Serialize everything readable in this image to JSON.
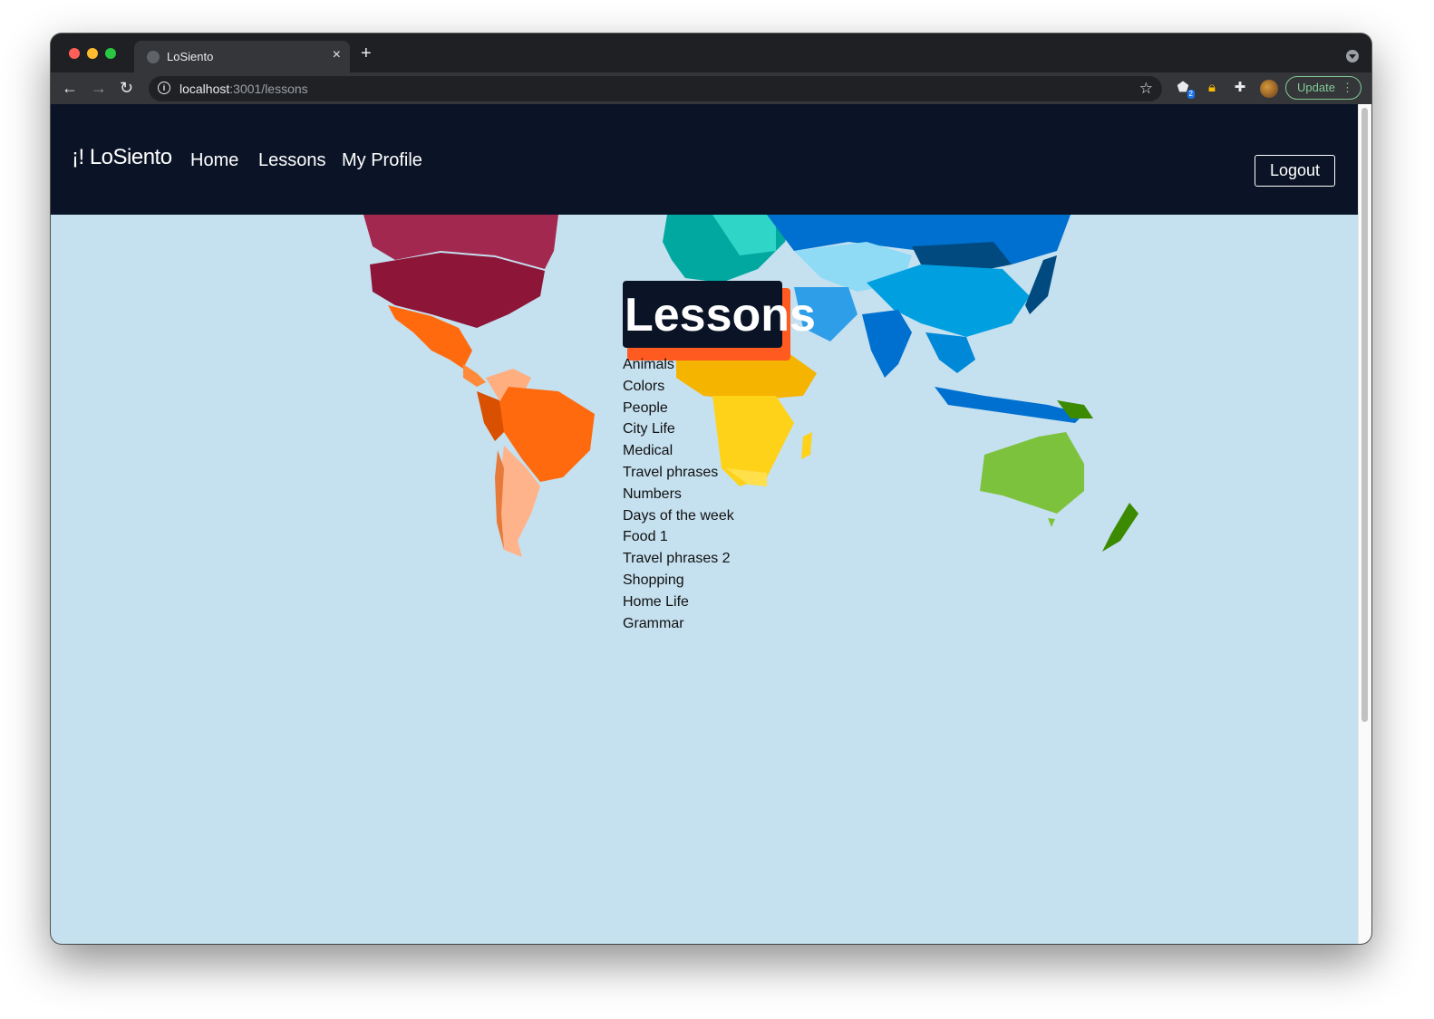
{
  "browser": {
    "tab_title": "LoSiento",
    "url_host": "localhost",
    "url_rest": ":3001/lessons",
    "extension_badge": "2",
    "update_label": "Update",
    "close_glyph": "×",
    "newtab_glyph": "+",
    "back_glyph": "←",
    "forward_glyph": "→",
    "reload_glyph": "↻",
    "star_glyph": "☆"
  },
  "nav": {
    "brand": "¡! LoSiento",
    "links": [
      "Home",
      "Lessons",
      "My Profile"
    ],
    "logout": "Logout"
  },
  "page": {
    "heading": "Lessons",
    "lessons": [
      "Animals",
      "Colors",
      "People",
      "City Life",
      "Medical",
      "Travel phrases",
      "Numbers",
      "Days of the week",
      "Food 1",
      "Travel phrases 2",
      "Shopping",
      "Home Life",
      "Grammar"
    ]
  },
  "colors": {
    "nav_bg": "#0b1426",
    "ocean": "#c5e0ef",
    "accent": "#ff5a1f"
  }
}
